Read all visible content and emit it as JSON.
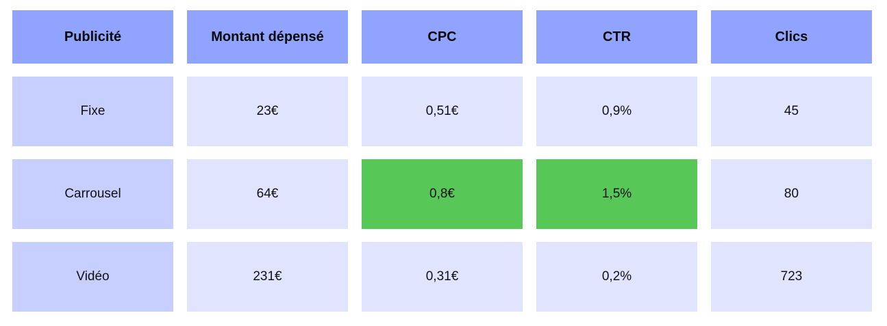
{
  "chart_data": {
    "type": "table",
    "columns": [
      "Publicité",
      "Montant dépensé",
      "CPC",
      "CTR",
      "Clics"
    ],
    "rows": [
      [
        "Fixe",
        "23€",
        "0,51€",
        "0,9%",
        "45"
      ],
      [
        "Carrousel",
        "64€",
        "0,8€",
        "1,5%",
        "80"
      ],
      [
        "Vidéo",
        "231€",
        "0,31€",
        "0,2%",
        "723"
      ]
    ],
    "highlighted_cells": [
      {
        "row": 1,
        "col": 2
      },
      {
        "row": 1,
        "col": 3
      }
    ]
  },
  "colors": {
    "header_bg": "#8fa3ff",
    "row_label_bg": "#c7cffe",
    "cell_bg": "#e0e4ff",
    "highlight_bg": "#57c857"
  }
}
